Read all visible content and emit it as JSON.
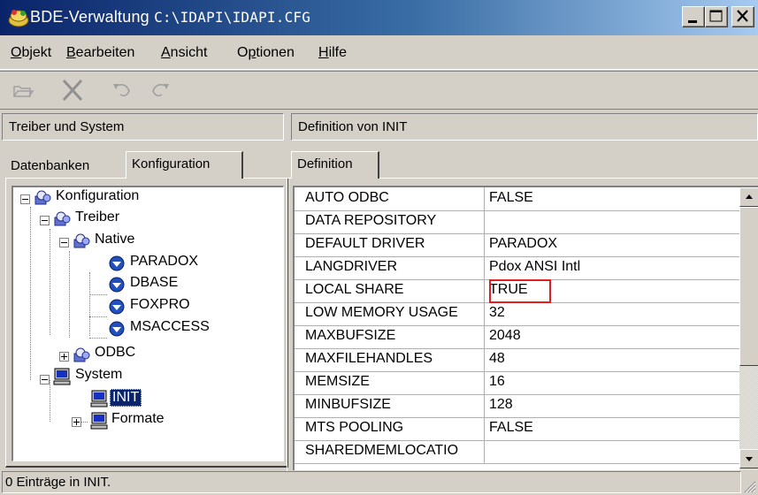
{
  "window": {
    "app_name": "BDE-Verwaltung",
    "file_path": "C:\\IDAPI\\IDAPI.CFG",
    "buttons": {
      "minimize": "minimize",
      "maximize": "maximize",
      "close": "close"
    }
  },
  "menu": {
    "items": [
      {
        "label": "Objekt",
        "accel": "O"
      },
      {
        "label": "Bearbeiten",
        "accel": "B"
      },
      {
        "label": "Ansicht",
        "accel": "A"
      },
      {
        "label": "Optionen",
        "accel": "p"
      },
      {
        "label": "Hilfe",
        "accel": "H"
      }
    ]
  },
  "toolbar": {
    "buttons": [
      "open-icon",
      "delete-icon",
      "undo-icon",
      "redo-icon"
    ]
  },
  "left_pane": {
    "header": "Treiber und System",
    "tabs": [
      "Datenbanken",
      "Konfiguration"
    ],
    "active_tab": "Konfiguration",
    "tree": [
      {
        "label": "Konfiguration",
        "level": 0,
        "expander": "minus",
        "icon": "config-icon"
      },
      {
        "label": "Treiber",
        "level": 1,
        "expander": "minus",
        "icon": "config-icon"
      },
      {
        "label": "Native",
        "level": 2,
        "expander": "minus",
        "icon": "config-icon"
      },
      {
        "label": "PARADOX",
        "level": 3,
        "expander": "",
        "icon": "driver-icon"
      },
      {
        "label": "DBASE",
        "level": 3,
        "expander": "",
        "icon": "driver-icon"
      },
      {
        "label": "FOXPRO",
        "level": 3,
        "expander": "",
        "icon": "driver-icon"
      },
      {
        "label": "MSACCESS",
        "level": 3,
        "expander": "",
        "icon": "driver-icon"
      },
      {
        "label": "ODBC",
        "level": 2,
        "expander": "plus",
        "icon": "config-icon"
      },
      {
        "label": "System",
        "level": 1,
        "expander": "minus",
        "icon": "computer-icon"
      },
      {
        "label": "INIT",
        "level": 2,
        "expander": "",
        "icon": "computer-icon",
        "selected": true
      },
      {
        "label": "Formate",
        "level": 2,
        "expander": "plus",
        "icon": "computer-icon"
      }
    ]
  },
  "right_pane": {
    "header": "Definition von INIT",
    "tabs": [
      "Definition"
    ],
    "rows": [
      {
        "key": "AUTO ODBC",
        "value": "FALSE"
      },
      {
        "key": "DATA REPOSITORY",
        "value": ""
      },
      {
        "key": "DEFAULT DRIVER",
        "value": "PARADOX"
      },
      {
        "key": "LANGDRIVER",
        "value": "Pdox ANSI Intl"
      },
      {
        "key": "LOCAL SHARE",
        "value": "TRUE",
        "highlighted": true
      },
      {
        "key": "LOW MEMORY USAGE",
        "value": "32"
      },
      {
        "key": "MAXBUFSIZE",
        "value": "2048"
      },
      {
        "key": "MAXFILEHANDLES",
        "value": "48"
      },
      {
        "key": "MEMSIZE",
        "value": "16"
      },
      {
        "key": "MINBUFSIZE",
        "value": "128"
      },
      {
        "key": "MTS POOLING",
        "value": "FALSE"
      },
      {
        "key": "SHAREDMEMLOCATIO",
        "value": ""
      }
    ]
  },
  "statusbar": {
    "text": "0 Einträge in INIT."
  },
  "colors": {
    "titlebar_start": "#0a246a",
    "titlebar_end": "#a6caf0",
    "highlight_border": "#e02020",
    "selection": "#0a246a"
  }
}
